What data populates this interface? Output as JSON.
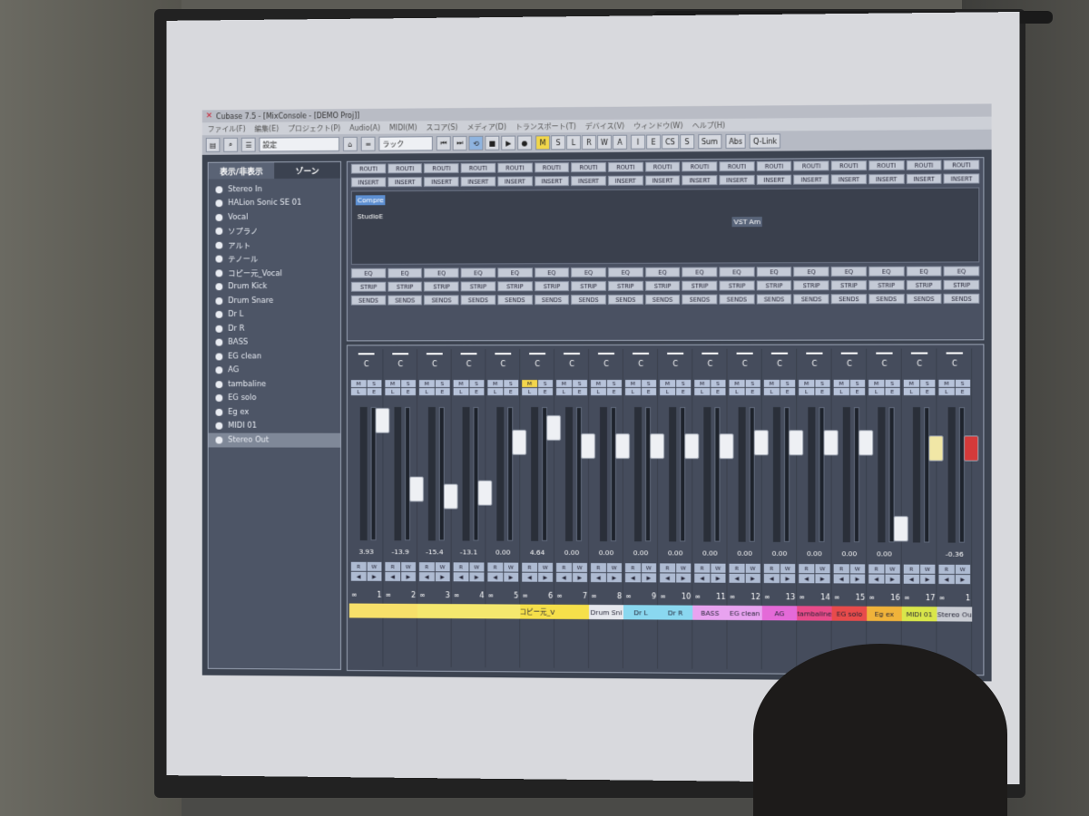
{
  "window": {
    "title": "Cubase 7.5 - [MixConsole - [DEMO Proj]]",
    "menu": [
      "ファイル(F)",
      "編集(E)",
      "プロジェクト(P)",
      "Audio(A)",
      "MIDI(M)",
      "スコア(S)",
      "メディア(D)",
      "トランスポート(T)",
      "デバイス(V)",
      "ウィンドウ(W)",
      "ヘルプ(H)"
    ]
  },
  "toolbar": {
    "preset_field": "設定",
    "rack_field": "ラック",
    "transport": [
      "⏮",
      "⏭",
      "⟲",
      "■",
      "▶",
      "●"
    ],
    "mode_buttons": [
      "M",
      "S",
      "L",
      "R",
      "W",
      "A"
    ],
    "other_buttons": [
      "I",
      "E",
      "CS",
      "S"
    ],
    "sum_label": "Sum",
    "abs_label": "Abs",
    "qlink_label": "Q-Link"
  },
  "sidebar": {
    "tab_visibility": "表示/非表示",
    "tab_zones": "ゾーン",
    "tracks": [
      "Stereo In",
      "HALion Sonic SE 01",
      "Vocal",
      "ソプラノ",
      "アルト",
      "テノール",
      "コピー元_Vocal",
      "Drum Kick",
      "Drum Snare",
      "Dr L",
      "Dr R",
      "BASS",
      "EG clean",
      "AG",
      "tambaline",
      "EG solo",
      "Eg ex",
      "MIDI 01",
      "Stereo Out"
    ]
  },
  "racks": {
    "routing_label": "ROUTI",
    "inserts_label": "INSERT",
    "eq_label": "EQ",
    "strip_label": "STRIP",
    "sends_label": "SENDS",
    "plugins": [
      "Compre",
      "StudioE",
      "VST Am"
    ]
  },
  "channels": [
    {
      "num": "1",
      "value": "3.93",
      "name": ""
    },
    {
      "num": "2",
      "value": "-13.9",
      "name": ""
    },
    {
      "num": "3",
      "value": "-15.4",
      "name": ""
    },
    {
      "num": "4",
      "value": "-13.1",
      "name": ""
    },
    {
      "num": "5",
      "value": "0.00",
      "name": ""
    },
    {
      "num": "6",
      "value": "4.64",
      "name": "コピー元_V"
    },
    {
      "num": "7",
      "value": "0.00",
      "name": ""
    },
    {
      "num": "8",
      "value": "0.00",
      "name": "Drum Sni"
    },
    {
      "num": "9",
      "value": "0.00",
      "name": "Dr L"
    },
    {
      "num": "10",
      "value": "0.00",
      "name": "Dr R"
    },
    {
      "num": "11",
      "value": "0.00",
      "name": "BASS"
    },
    {
      "num": "12",
      "value": "0.00",
      "name": "EG clean"
    },
    {
      "num": "13",
      "value": "0.00",
      "name": "AG"
    },
    {
      "num": "14",
      "value": "0.00",
      "name": "tambaline"
    },
    {
      "num": "15",
      "value": "0.00",
      "name": "EG solo"
    },
    {
      "num": "16",
      "value": "0.00",
      "name": "Eg ex"
    },
    {
      "num": "17",
      "value": "",
      "name": "MIDI 01"
    },
    {
      "num": "1",
      "value": "-0.36",
      "name": "Stereo Ou"
    }
  ],
  "colors": {
    "selected_plugin": "#5d8fd1",
    "solo_on": "#f3d64c",
    "master_fader": "#d43a3a"
  }
}
